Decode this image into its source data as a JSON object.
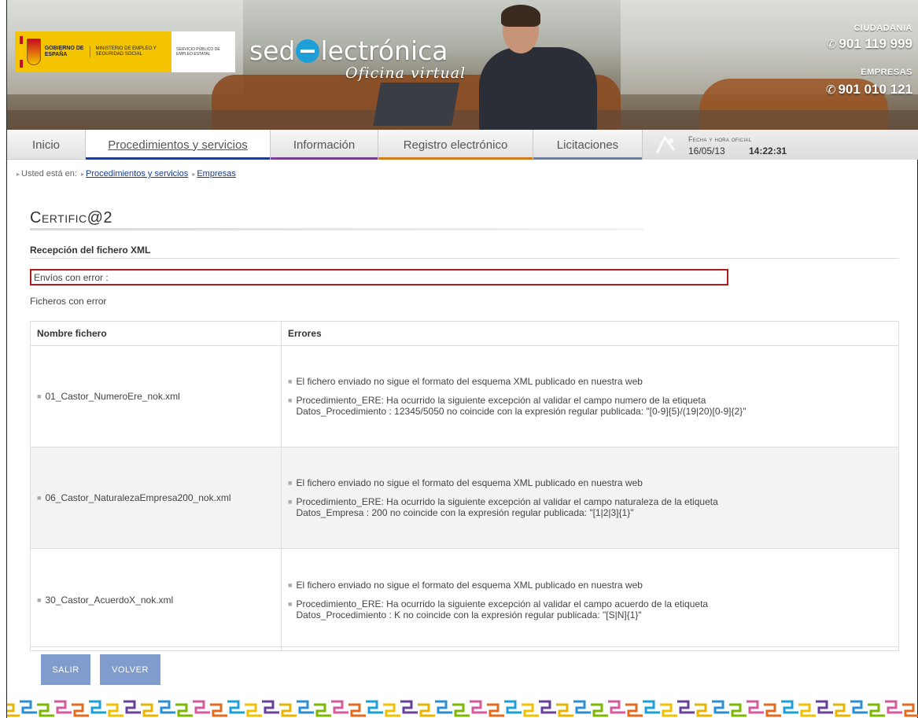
{
  "header": {
    "gov_label": "GOBIERNO DE ESPAÑA",
    "ministry_label": "MINISTERIO DE EMPLEO Y SEGURIDAD SOCIAL",
    "sepe_label": "SERVICIO PÚBLICO DE EMPLEO ESTATAL",
    "site_name_pre": "sed",
    "site_name_post": "lectrónica",
    "site_subtitle": "Oficina virtual",
    "citizens_label": "CIUDADANIA",
    "citizens_phone": "901 119 999",
    "companies_label": "EMPRESAS",
    "companies_phone": "901 010 121"
  },
  "nav": {
    "tabs": [
      {
        "label": "Inicio",
        "color": "#1a3c8a"
      },
      {
        "label": "Procedimientos y servicios",
        "color": "#1a3c8a"
      },
      {
        "label": "Información",
        "color": "#7a3f95"
      },
      {
        "label": "Registro electrónico",
        "color": "#d77a1c"
      },
      {
        "label": "Licitaciones",
        "color": "#6e7f9a"
      }
    ],
    "datetime_label": "Fecha y hora oficial",
    "date": "16/05/13",
    "time": "14:22:31"
  },
  "breadcrumb": {
    "prefix": "Usted está en:",
    "items": [
      "Procedimientos y servicios",
      "Empresas"
    ]
  },
  "page": {
    "title": "Certific@2",
    "subtitle": "Recepción del fichero XML",
    "error_box": "Envíos con error :",
    "files_with_error": "Ficheros con error"
  },
  "table": {
    "headers": [
      "Nombre fichero",
      "Errores"
    ],
    "rows": [
      {
        "file": "01_Castor_NumeroEre_nok.xml",
        "errors": [
          "El fichero enviado no sigue el formato del esquema XML publicado en nuestra web",
          "Procedimiento_ERE: Ha ocurrido la siguiente excepción al validar el campo numero de la etiqueta Datos_Procedimiento : 12345/5050 no coincide con la expresión regular publicada: \"[0-9]{5}/(19|20)[0-9]{2}\""
        ]
      },
      {
        "file": "06_Castor_NaturalezaEmpresa200_nok.xml",
        "errors": [
          "El fichero enviado no sigue el formato del esquema XML publicado en nuestra web",
          "Procedimiento_ERE: Ha ocurrido la siguiente excepción al validar el campo naturaleza de la etiqueta Datos_Empresa : 200 no coincide con la expresión regular publicada: \"[1|2|3]{1}\""
        ]
      },
      {
        "file": "30_Castor_AcuerdoX_nok.xml",
        "errors": [
          "El fichero enviado no sigue el formato del esquema XML publicado en nuestra web",
          "Procedimiento_ERE: Ha ocurrido la siguiente excepción al validar el campo acuerdo de la etiqueta Datos_Procedimiento : K no coincide con la expresión regular publicada: \"[S|N]{1}\""
        ]
      }
    ]
  },
  "buttons": {
    "exit": "SALIR",
    "back": "VOLVER"
  },
  "colors": {
    "button": "#7f9ccc",
    "error_border": "#b01a1a",
    "link": "#1a3c8a"
  }
}
